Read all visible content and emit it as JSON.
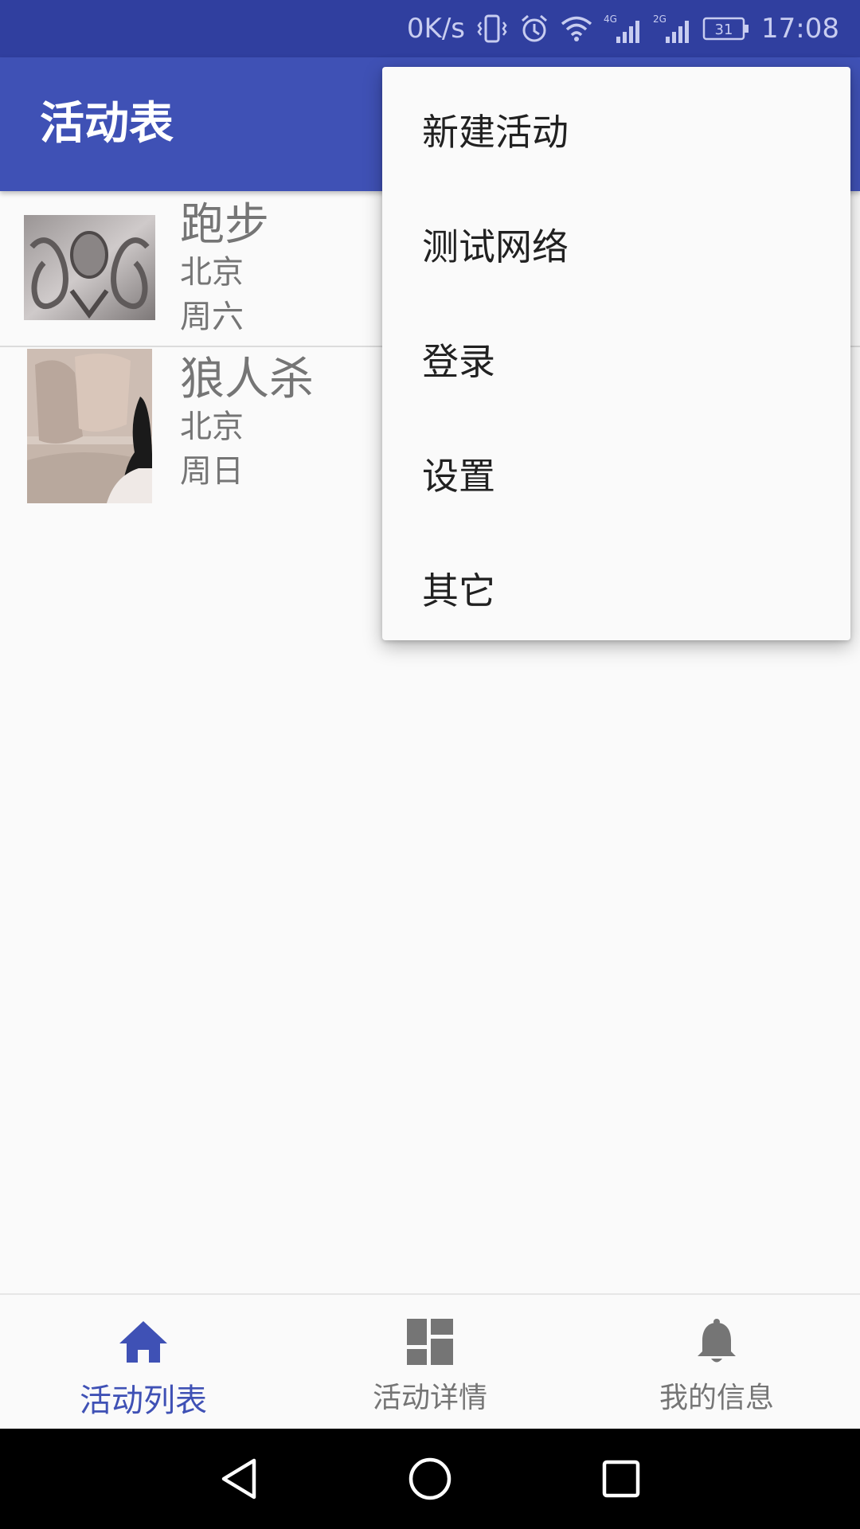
{
  "status_bar": {
    "speed": "0K/s",
    "network_1": "4G",
    "network_2": "2G",
    "battery": "31",
    "time": "17:08"
  },
  "app_bar": {
    "title": "活动表"
  },
  "activities": [
    {
      "title": "跑步",
      "city": "北京",
      "day": "周六"
    },
    {
      "title": "狼人杀",
      "city": "北京",
      "day": "周日"
    }
  ],
  "menu": {
    "items": [
      "新建活动",
      "测试网络",
      "登录",
      "设置",
      "其它"
    ]
  },
  "bottom_nav": {
    "tabs": [
      {
        "label": "活动列表",
        "icon": "home-icon",
        "active": true
      },
      {
        "label": "活动详情",
        "icon": "dashboard-icon",
        "active": false
      },
      {
        "label": "我的信息",
        "icon": "bell-icon",
        "active": false
      }
    ]
  },
  "colors": {
    "primary": "#3f51b5",
    "primary_dark": "#303f9f",
    "text_secondary": "#757575"
  }
}
